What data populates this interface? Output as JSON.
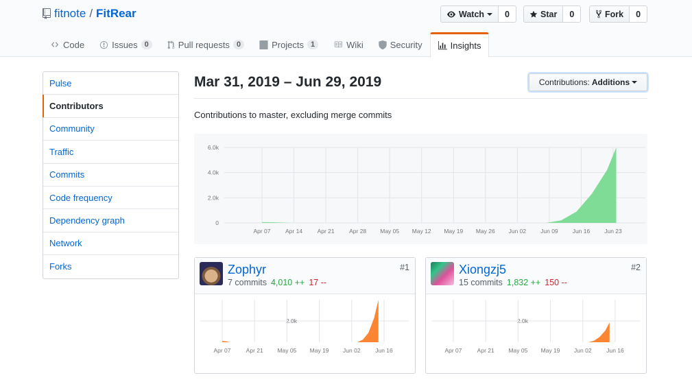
{
  "repo": {
    "owner": "fitnote",
    "separator": "/",
    "name": "FitRear"
  },
  "actions": [
    {
      "label": "Watch",
      "count": "0"
    },
    {
      "label": "Star",
      "count": "0"
    },
    {
      "label": "Fork",
      "count": "0"
    }
  ],
  "tabs": [
    {
      "label": "Code"
    },
    {
      "label": "Issues",
      "counter": "0"
    },
    {
      "label": "Pull requests",
      "counter": "0"
    },
    {
      "label": "Projects",
      "counter": "1"
    },
    {
      "label": "Wiki"
    },
    {
      "label": "Security"
    },
    {
      "label": "Insights"
    }
  ],
  "menu": [
    "Pulse",
    "Contributors",
    "Community",
    "Traffic",
    "Commits",
    "Code frequency",
    "Dependency graph",
    "Network",
    "Forks"
  ],
  "header": {
    "date_range": "Mar 31, 2019 – Jun 29, 2019",
    "contrib_label": "Contributions:",
    "contrib_value": "Additions",
    "subtitle": "Contributions to master, excluding merge commits"
  },
  "colors": {
    "accent": "#e36209",
    "link": "#0366d6",
    "main_area": "#7fdc97",
    "contrib_area": "#fb8532"
  },
  "chart_data": [
    {
      "type": "area",
      "x_ticks": [
        "Apr 07",
        "Apr 14",
        "Apr 21",
        "Apr 28",
        "May 05",
        "May 12",
        "May 19",
        "May 26",
        "Jun 02",
        "Jun 09",
        "Jun 16",
        "Jun 23"
      ],
      "y_ticks": [
        "0",
        "2.0k",
        "4.0k",
        "6.0k"
      ],
      "ylim": [
        0,
        6000
      ],
      "points": [
        [
          0,
          60
        ],
        [
          0.4,
          50
        ],
        [
          1,
          0
        ],
        [
          8,
          0
        ],
        [
          9.3,
          0
        ],
        [
          9.8,
          200
        ],
        [
          10.3,
          900
        ],
        [
          10.8,
          2300
        ],
        [
          11.3,
          4200
        ],
        [
          11.6,
          6000
        ]
      ],
      "grid": true
    },
    {
      "type": "area",
      "contributor": "Zophyr",
      "x_ticks": [
        "Apr 07",
        "Apr 21",
        "May 05",
        "May 19",
        "Jun 02",
        "Jun 16"
      ],
      "y_ticks": [
        "2.0k"
      ],
      "ylim": [
        0,
        4000
      ],
      "points": [
        [
          0,
          120
        ],
        [
          0.3,
          80
        ],
        [
          0.6,
          0
        ],
        [
          8.5,
          0
        ],
        [
          9.6,
          0
        ],
        [
          10.0,
          250
        ],
        [
          10.4,
          900
        ],
        [
          10.8,
          2300
        ],
        [
          11.1,
          4000
        ],
        [
          11.1,
          0
        ]
      ],
      "grid": true
    },
    {
      "type": "area",
      "contributor": "Xiongzj5",
      "x_ticks": [
        "Apr 07",
        "Apr 21",
        "May 05",
        "May 19",
        "Jun 02",
        "Jun 16"
      ],
      "y_ticks": [
        "2.0k"
      ],
      "ylim": [
        0,
        4000
      ],
      "points": [
        [
          0,
          0
        ],
        [
          8.5,
          0
        ],
        [
          9.6,
          0
        ],
        [
          10.0,
          150
        ],
        [
          10.4,
          500
        ],
        [
          10.8,
          1100
        ],
        [
          11.1,
          1850
        ],
        [
          11.1,
          0
        ]
      ],
      "grid": true
    }
  ],
  "contributors": [
    {
      "name": "Zophyr",
      "commits": "7 commits",
      "additions": "4,010 ++",
      "deletions": "17 --",
      "rank": "#1"
    },
    {
      "name": "Xiongzj5",
      "commits": "15 commits",
      "additions": "1,832 ++",
      "deletions": "150 --",
      "rank": "#2"
    }
  ]
}
